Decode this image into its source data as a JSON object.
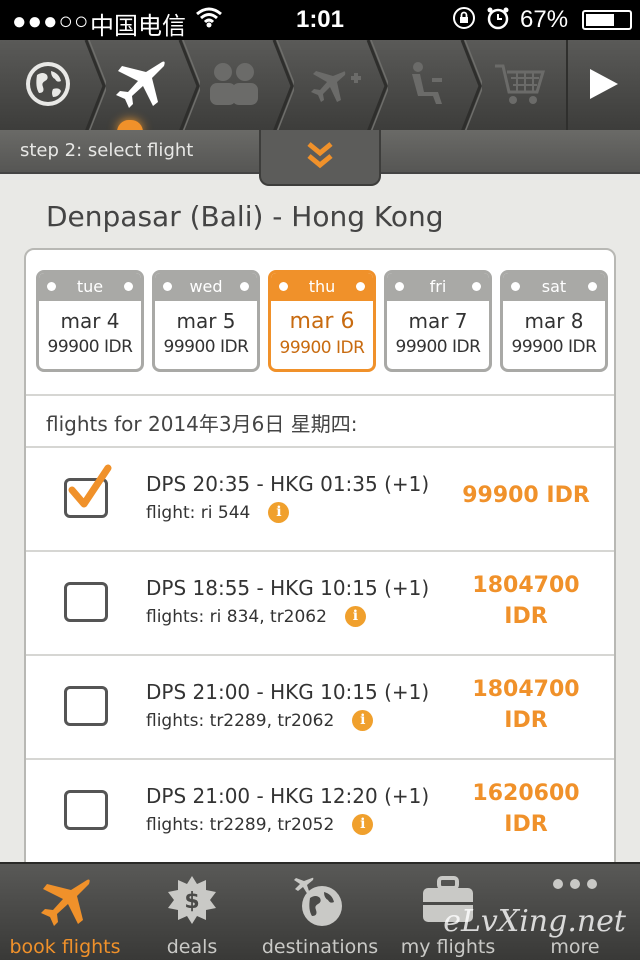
{
  "status_bar": {
    "signal": "●●●○○",
    "carrier": "中国电信",
    "time": "1:01",
    "battery": "67%",
    "battery_level": 0.67
  },
  "steps": {
    "items": [
      {
        "icon": "globe-icon"
      },
      {
        "icon": "plane-icon"
      },
      {
        "icon": "passengers-icon"
      },
      {
        "icon": "plane-plus-icon"
      },
      {
        "icon": "seat-icon"
      },
      {
        "icon": "cart-icon"
      }
    ],
    "current_step_label": "step 2: select flight",
    "next_icon": "play-icon"
  },
  "route_title": "Denpasar (Bali) - Hong Kong",
  "dates": [
    {
      "weekday": "tue",
      "day": "mar 4",
      "price": "99900 IDR",
      "selected": false
    },
    {
      "weekday": "wed",
      "day": "mar 5",
      "price": "99900 IDR",
      "selected": false
    },
    {
      "weekday": "thu",
      "day": "mar 6",
      "price": "99900 IDR",
      "selected": true
    },
    {
      "weekday": "fri",
      "day": "mar 7",
      "price": "99900 IDR",
      "selected": false
    },
    {
      "weekday": "sat",
      "day": "mar 8",
      "price": "99900 IDR",
      "selected": false
    }
  ],
  "flights_header": "flights for 2014年3月6日 星期四:",
  "flights": [
    {
      "route": "DPS 20:35 - HKG 01:35 (+1)",
      "flight_no": "flight: ri 544",
      "price_line1": "99900 IDR",
      "price_line2": "",
      "checked": true
    },
    {
      "route": "DPS 18:55 - HKG 10:15 (+1)",
      "flight_no": "flights: ri 834, tr2062",
      "price_line1": "1804700",
      "price_line2": "IDR",
      "checked": false
    },
    {
      "route": "DPS 21:00 - HKG 10:15 (+1)",
      "flight_no": "flights: tr2289, tr2062",
      "price_line1": "1804700",
      "price_line2": "IDR",
      "checked": false
    },
    {
      "route": "DPS 21:00 - HKG 12:20 (+1)",
      "flight_no": "flights: tr2289, tr2052",
      "price_line1": "1620600",
      "price_line2": "IDR",
      "checked": false
    }
  ],
  "info_glyph": "i",
  "tabbar": [
    {
      "label": "book flights",
      "icon": "plane-icon",
      "active": true
    },
    {
      "label": "deals",
      "icon": "deals-badge-icon",
      "active": false
    },
    {
      "label": "destinations",
      "icon": "globe-plane-icon",
      "active": false
    },
    {
      "label": "my flights",
      "icon": "suitcase-icon",
      "active": false
    },
    {
      "label": "more",
      "icon": "more-dots-icon",
      "active": false
    }
  ],
  "watermark": "eLvXing.net",
  "colors": {
    "accent": "#f0912a",
    "toolbar": "#4a4a48",
    "muted_step": "#6b6b69"
  }
}
